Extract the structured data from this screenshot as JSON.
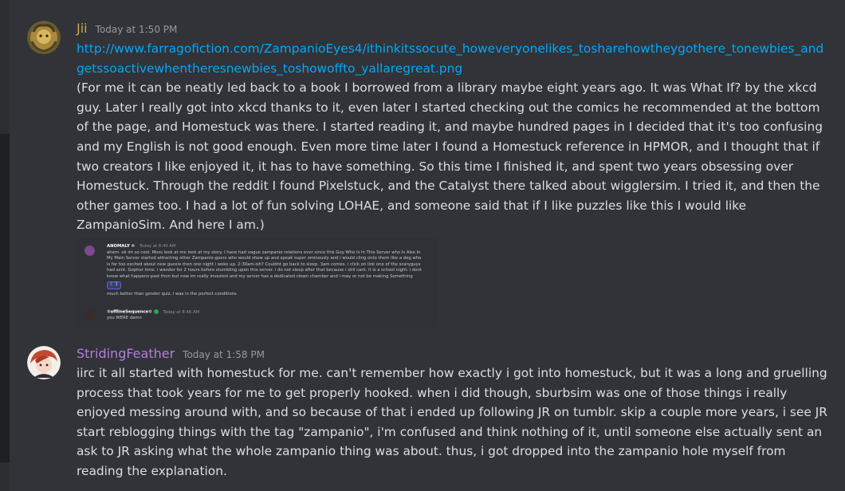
{
  "messages": [
    {
      "username": "Jii",
      "username_color": "#d3a64c",
      "timestamp": "Today at 1:50 PM",
      "link": "http://www.farragofiction.com/ZampanioEyes4/ithinkitssocute_howeveryonelikes_tosharehowtheygothere_tonewbies_andgetssoactivewhentheresnewbies_toshowoffto_yallaregreat.png",
      "text": "(For me it can be neatly led back to a book I borrowed from a library maybe eight years ago. It was What If? by the xkcd guy. Later I really got into xkcd thanks to it, even later I started checking out the comics he recommended at the bottom of the page, and Homestuck was there. I started reading it, and maybe hundred pages in I decided that it's too confusing and my English is not good enough. Even more time later I found a Homestuck reference in HPMOR, and I thought that if two creators I like enjoyed it, it has to have something. So this time I finished it, and spent two years obsessing over Homestuck. Through the reddit I found Pixelstuck, and the Catalyst there talked about wigglersim. I tried it, and then the other games too. I had a lot of fun solving LOHAE, and someone said that if I like puzzles like this I would like ZampanioSim. And here I am.)",
      "attachment": {
        "first": {
          "username": "ANOMALY",
          "timestamp": "Today at 8:40 AM",
          "text": "ahem. ok im so cool. Moss look at me look at my story. I have had vague zampanio relations ever since this Guy Who Is In This Server who Is Also In My Main Server started attracting other Zampanio-goers who would show up and speak super ominously and i would cling onto them like a dog who is far too excited about new guests   then one night i woke up. 2:30am-ish? Couldnt go back to sleep. 3am comes. i click on link one of the scaryguys had sent. Gopher time. i wander for 2 hours before stumbling upon this server. i do not sleep after that because i still cant. it is a school night. i dont know what happens past then but now im really invested and my server has a dedicated clown chamber and i may or not be making Something",
          "reaction_count": "1",
          "followup": "much better than gender quiz. i was in the perfect conditions"
        },
        "second": {
          "username": "offlineSequence",
          "timestamp": "Today at 8:46 AM",
          "text": "you WERE damn"
        }
      }
    },
    {
      "username": "StridingFeather",
      "username_color": "#b57edc",
      "timestamp": "Today at 1:58 PM",
      "text": "iirc it all started with homestuck for me. can't remember how exactly i got into homestuck, but it was a long and gruelling process that took years for me to get properly hooked. when i did though, sburbsim was one of those things i really enjoyed messing around with, and so because of that i ended up following JR on tumblr. skip a couple more years, i see JR start reblogging things with the tag \"zampanio\", i'm confused and think nothing of it, until someone else actually sent an ask to JR asking what the whole zampanio thing was about. thus, i got dropped into the zampanio hole myself from reading the explanation."
    }
  ]
}
